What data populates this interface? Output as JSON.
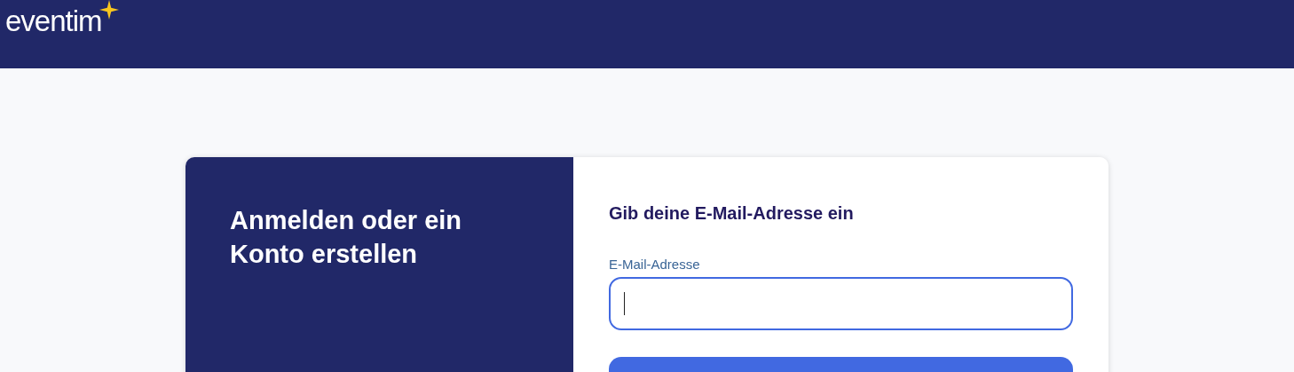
{
  "header": {
    "logo": "eventim"
  },
  "card": {
    "heading": "Anmelden oder ein Konto erstellen",
    "form": {
      "title": "Gib deine E-Mail-Adresse ein",
      "email_field": {
        "label": "E-Mail-Adresse",
        "focused": true
      }
    }
  }
}
